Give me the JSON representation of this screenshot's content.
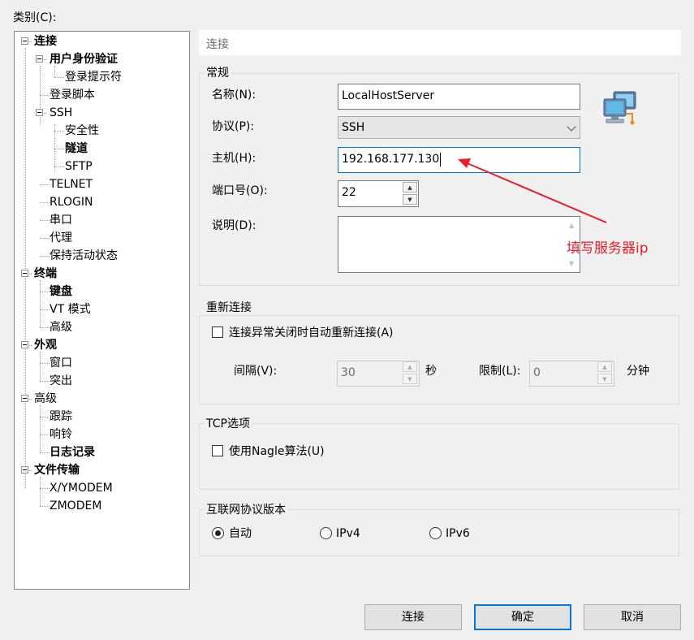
{
  "category_label": "类别(C):",
  "category_accel": "C",
  "tree": [
    {
      "label": "连接",
      "bold": true
    },
    {
      "label": "用户身份验证",
      "bold": true
    },
    {
      "label": "登录提示符",
      "bold": false
    },
    {
      "label": "登录脚本",
      "bold": false
    },
    {
      "label": "SSH",
      "bold": false
    },
    {
      "label": "安全性",
      "bold": false
    },
    {
      "label": "隧道",
      "bold": true
    },
    {
      "label": "SFTP",
      "bold": false
    },
    {
      "label": "TELNET",
      "bold": false
    },
    {
      "label": "RLOGIN",
      "bold": false
    },
    {
      "label": "串口",
      "bold": false
    },
    {
      "label": "代理",
      "bold": false
    },
    {
      "label": "保持活动状态",
      "bold": false
    },
    {
      "label": "终端",
      "bold": true
    },
    {
      "label": "键盘",
      "bold": true
    },
    {
      "label": "VT 模式",
      "bold": false
    },
    {
      "label": "高级",
      "bold": false
    },
    {
      "label": "外观",
      "bold": true
    },
    {
      "label": "窗口",
      "bold": false
    },
    {
      "label": "突出",
      "bold": false
    },
    {
      "label": "高级",
      "bold": false
    },
    {
      "label": "跟踪",
      "bold": false
    },
    {
      "label": "响铃",
      "bold": false
    },
    {
      "label": "日志记录",
      "bold": true
    },
    {
      "label": "文件传输",
      "bold": true
    },
    {
      "label": "X/YMODEM",
      "bold": false
    },
    {
      "label": "ZMODEM",
      "bold": false
    }
  ],
  "section_header": "连接",
  "general": {
    "title": "常规",
    "name_label": "名称(N):",
    "name_value": "LocalHostServer",
    "protocol_label": "协议(P):",
    "protocol_value": "SSH",
    "host_label": "主机(H):",
    "host_value": "192.168.177.130",
    "port_label": "端口号(O):",
    "port_value": "22",
    "desc_label": "说明(D):",
    "desc_value": ""
  },
  "reconnect": {
    "title": "重新连接",
    "checkbox_label": "连接异常关闭时自动重新连接(A)",
    "checked": false,
    "interval_label": "间隔(V):",
    "interval_value": "30",
    "interval_unit": "秒",
    "limit_label": "限制(L):",
    "limit_value": "0",
    "limit_unit": "分钟"
  },
  "tcp": {
    "title": "TCP选项",
    "nagle_label": "使用Nagle算法(U)",
    "checked": false
  },
  "ip_version": {
    "title": "互联网协议版本",
    "options": [
      "自动",
      "IPv4",
      "IPv6"
    ],
    "selected": "自动"
  },
  "buttons": {
    "connect": "连接",
    "ok": "确定",
    "cancel": "取消"
  },
  "annotation": "填写服务器ip",
  "colors": {
    "annotation": "#e81e2a",
    "focus": "#0078d7"
  }
}
